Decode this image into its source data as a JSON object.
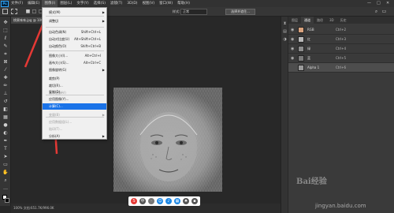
{
  "menubar": {
    "logo": "Ps",
    "items": [
      "文件(F)",
      "编辑(E)",
      "图像(I)",
      "图层(L)",
      "文字(Y)",
      "选择(S)",
      "滤镜(T)",
      "3D(D)",
      "视图(V)",
      "窗口(W)",
      "帮助(H)"
    ],
    "active_index": 2,
    "window_controls": [
      "—",
      "□",
      "✕"
    ]
  },
  "options": {
    "style_label": "样式:",
    "style_value": "正常",
    "select_mask_button": "选择并遮住..."
  },
  "document": {
    "tab_label": "桃蜜味味.jpg @ 100% (",
    "status_text": "100%    文档:651.7K/996.0K"
  },
  "image_menu": {
    "items": [
      {
        "label": "模式(M)",
        "shortcut": "",
        "submenu": true,
        "disabled": false
      },
      {
        "label": "调整(J)",
        "shortcut": "",
        "submenu": true,
        "disabled": false
      },
      {
        "label": "自动色调(N)",
        "shortcut": "Shift+Ctrl+L",
        "submenu": false,
        "disabled": false
      },
      {
        "label": "自动对比度(U)",
        "shortcut": "Alt+Shift+Ctrl+L",
        "submenu": false,
        "disabled": false
      },
      {
        "label": "自动颜色(O)",
        "shortcut": "Shift+Ctrl+B",
        "submenu": false,
        "disabled": false
      },
      {
        "label": "图像大小(I)...",
        "shortcut": "Alt+Ctrl+I",
        "submenu": false,
        "disabled": false
      },
      {
        "label": "画布大小(S)...",
        "shortcut": "Alt+Ctrl+C",
        "submenu": false,
        "disabled": false
      },
      {
        "label": "图像旋转(G)",
        "shortcut": "",
        "submenu": true,
        "disabled": false
      },
      {
        "label": "裁剪(P)",
        "shortcut": "",
        "submenu": false,
        "disabled": false
      },
      {
        "label": "裁切(R)...",
        "shortcut": "",
        "submenu": false,
        "disabled": false
      },
      {
        "label": "显示全部(V)",
        "shortcut": "",
        "submenu": false,
        "disabled": true
      },
      {
        "label": "复制(D)...",
        "shortcut": "",
        "submenu": false,
        "disabled": false
      },
      {
        "label": "应用图像(Y)...",
        "shortcut": "",
        "submenu": false,
        "disabled": false
      },
      {
        "label": "计算(C)...",
        "shortcut": "",
        "submenu": false,
        "disabled": false,
        "selected": true
      },
      {
        "label": "变量(B)",
        "shortcut": "",
        "submenu": true,
        "disabled": true
      },
      {
        "label": "应用数据组(L)...",
        "shortcut": "",
        "submenu": false,
        "disabled": true
      },
      {
        "label": "陷印(T)...",
        "shortcut": "",
        "submenu": false,
        "disabled": true
      },
      {
        "label": "分析(A)",
        "shortcut": "",
        "submenu": true,
        "disabled": false
      }
    ]
  },
  "panel": {
    "tabs": [
      "图层",
      "通道",
      "路径",
      "3D",
      "历史"
    ],
    "active_tab": 1,
    "channels": [
      {
        "name": "RGB",
        "shortcut": "Ctrl+2",
        "thumb_color": "#d9a27d"
      },
      {
        "name": "红",
        "shortcut": "Ctrl+3",
        "thumb_color": "#b8b8b8"
      },
      {
        "name": "绿",
        "shortcut": "Ctrl+4",
        "thumb_color": "#8c8c8c"
      },
      {
        "name": "蓝",
        "shortcut": "Ctrl+5",
        "thumb_color": "#7a7a7a"
      },
      {
        "name": "Alpha 1",
        "shortcut": "Ctrl+6",
        "thumb_color": "#9a9a9a",
        "selected": true
      }
    ]
  },
  "watermark": {
    "text": "Bai经验",
    "url": "jingyan.baidu.com"
  },
  "colors": {
    "accent": "#1a73e8",
    "annotation_arrow": "#e53935"
  }
}
